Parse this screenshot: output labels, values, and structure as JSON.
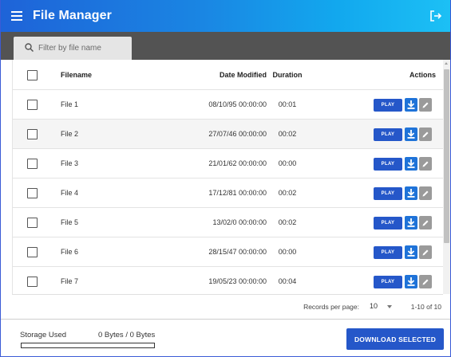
{
  "app": {
    "title": "File Manager"
  },
  "filter": {
    "placeholder": "Filter by file name"
  },
  "table": {
    "headers": {
      "filename": "Filename",
      "date": "Date Modified",
      "duration": "Duration",
      "actions": "Actions"
    },
    "play_label": "PLAY",
    "rows": [
      {
        "name": "File 1",
        "date": "08/10/95 00:00:00",
        "duration": "00:01"
      },
      {
        "name": "File 2",
        "date": "27/07/46 00:00:00",
        "duration": "00:02"
      },
      {
        "name": "File 3",
        "date": "21/01/62 00:00:00",
        "duration": "00:00"
      },
      {
        "name": "File 4",
        "date": "17/12/81 00:00:00",
        "duration": "00:02"
      },
      {
        "name": "File 5",
        "date": "13/02/0 00:00:00",
        "duration": "00:02"
      },
      {
        "name": "File 6",
        "date": "28/15/47 00:00:00",
        "duration": "00:00"
      },
      {
        "name": "File 7",
        "date": "19/05/23 00:00:00",
        "duration": "00:04"
      }
    ]
  },
  "pagination": {
    "records_label": "Records per page:",
    "per_page": "10",
    "range": "1-10 of 10"
  },
  "storage": {
    "label": "Storage Used",
    "value": "0 Bytes / 0 Bytes",
    "fraction": 0
  },
  "actions": {
    "download_selected": "DOWNLOAD SELECTED"
  },
  "colors": {
    "accent": "#2557c9",
    "download": "#1f73d8",
    "edit": "#9a9a9a",
    "filterbar": "#535353"
  },
  "icons": {
    "menu": "menu-icon",
    "logout": "logout-icon",
    "search": "search-icon",
    "download": "download-icon",
    "edit": "pencil-icon"
  }
}
